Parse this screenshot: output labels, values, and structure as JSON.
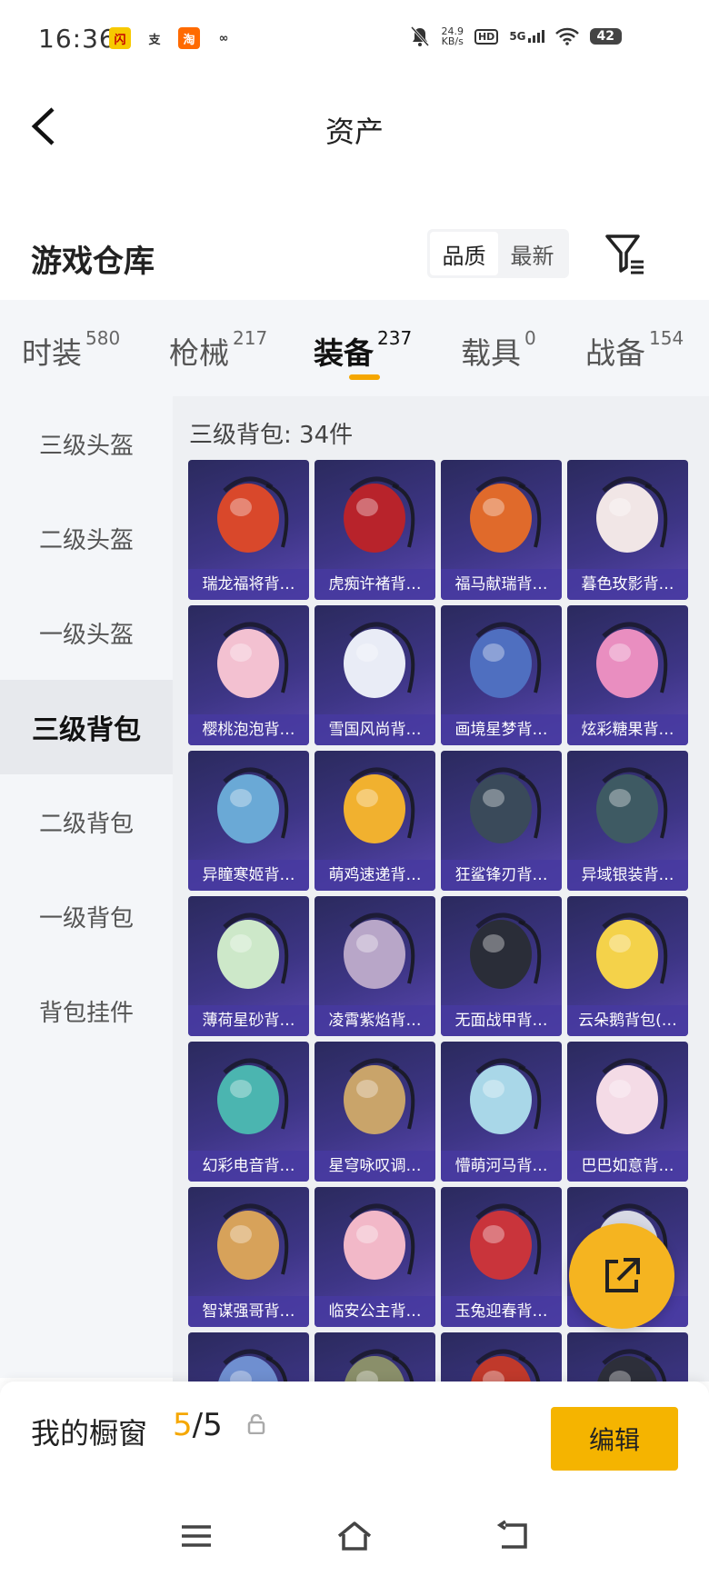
{
  "status_bar": {
    "time": "16:36",
    "apps": [
      {
        "icon": "news-app-icon",
        "glyph": "闪",
        "bg": "#f7c900",
        "fg": "#c40000"
      },
      {
        "icon": "alipay-icon",
        "glyph": "支",
        "bg": "#ffffff",
        "fg": "#333333"
      },
      {
        "icon": "taobao-icon",
        "glyph": "淘",
        "bg": "#ff6a00",
        "fg": "#ffffff"
      },
      {
        "icon": "link-app-icon",
        "glyph": "∞",
        "bg": "#ffffff",
        "fg": "#333333"
      }
    ],
    "net_rate_value": "24.9",
    "net_rate_unit": "KB/s",
    "hd": "HD",
    "signal": "5G",
    "battery": "42"
  },
  "header": {
    "title": "资产",
    "back_icon": "back-chevron-icon"
  },
  "warehouse": {
    "title": "游戏仓库",
    "sort_options": [
      {
        "label": "品质",
        "active": true
      },
      {
        "label": "最新",
        "active": false
      }
    ],
    "filter_icon": "filter-icon"
  },
  "tabs": [
    {
      "label": "时装",
      "count": "580",
      "active": false
    },
    {
      "label": "枪械",
      "count": "217",
      "active": false
    },
    {
      "label": "装备",
      "count": "237",
      "active": true
    },
    {
      "label": "载具",
      "count": "0",
      "active": false
    },
    {
      "label": "战备",
      "count": "154",
      "active": false
    }
  ],
  "sidebar": [
    {
      "label": "三级头盔",
      "active": false
    },
    {
      "label": "二级头盔",
      "active": false
    },
    {
      "label": "一级头盔",
      "active": false
    },
    {
      "label": "三级背包",
      "active": true
    },
    {
      "label": "二级背包",
      "active": false
    },
    {
      "label": "一级背包",
      "active": false
    },
    {
      "label": "背包挂件",
      "active": false
    }
  ],
  "content": {
    "count_label": "三级背包: 34件",
    "items": [
      {
        "name": "瑞龙福将背…",
        "color": "#d9482b"
      },
      {
        "name": "虎痴许褚背…",
        "color": "#b8232b"
      },
      {
        "name": "福马献瑞背…",
        "color": "#e06a2b"
      },
      {
        "name": "暮色玫影背…",
        "color": "#f1e6e6"
      },
      {
        "name": "樱桃泡泡背…",
        "color": "#f3c1d1"
      },
      {
        "name": "雪国风尚背…",
        "color": "#e9ecf6"
      },
      {
        "name": "画境星梦背…",
        "color": "#4f6fc0"
      },
      {
        "name": "炫彩糖果背…",
        "color": "#e98ec0"
      },
      {
        "name": "异瞳寒姬背…",
        "color": "#6aa9d6"
      },
      {
        "name": "萌鸡速递背…",
        "color": "#f1b12f"
      },
      {
        "name": "狂鲨锋刃背…",
        "color": "#3a4a5a"
      },
      {
        "name": "异域银装背…",
        "color": "#3e5a63"
      },
      {
        "name": "薄荷星砂背…",
        "color": "#cde8c9"
      },
      {
        "name": "凌霄紫焰背…",
        "color": "#b8a6c8"
      },
      {
        "name": "无面战甲背…",
        "color": "#2a2d38"
      },
      {
        "name": "云朵鹅背包(…",
        "color": "#f4d24a"
      },
      {
        "name": "幻彩电音背…",
        "color": "#4bb5b0"
      },
      {
        "name": "星穹咏叹调…",
        "color": "#c9a46a"
      },
      {
        "name": "懵萌河马背…",
        "color": "#a9d7e8"
      },
      {
        "name": "巴巴如意背…",
        "color": "#f4dbe6"
      },
      {
        "name": "智谋强哥背…",
        "color": "#d7a25a"
      },
      {
        "name": "临安公主背…",
        "color": "#f2b8c8"
      },
      {
        "name": "玉兔迎春背…",
        "color": "#c9343b"
      },
      {
        "name": "",
        "color": "#d7d9e4"
      },
      {
        "name": "",
        "color": "#6f8fd0"
      },
      {
        "name": "",
        "color": "#8a8f6a"
      },
      {
        "name": "",
        "color": "#c0392b"
      },
      {
        "name": "",
        "color": "#2d2f3a"
      }
    ]
  },
  "fab_icon": "share-export-icon",
  "bottom_bar": {
    "label": "我的橱窗",
    "current": "5",
    "separator": "/",
    "total": "5",
    "lock_icon": "lock-icon",
    "edit_label": "编辑"
  },
  "system_nav": {
    "menu_icon": "menu-icon",
    "home_icon": "home-icon",
    "back_icon": "back-return-icon"
  },
  "colors": {
    "accent": "#f5a700",
    "card_bg": "#3d3585",
    "panel_bg": "#eef0f3"
  }
}
